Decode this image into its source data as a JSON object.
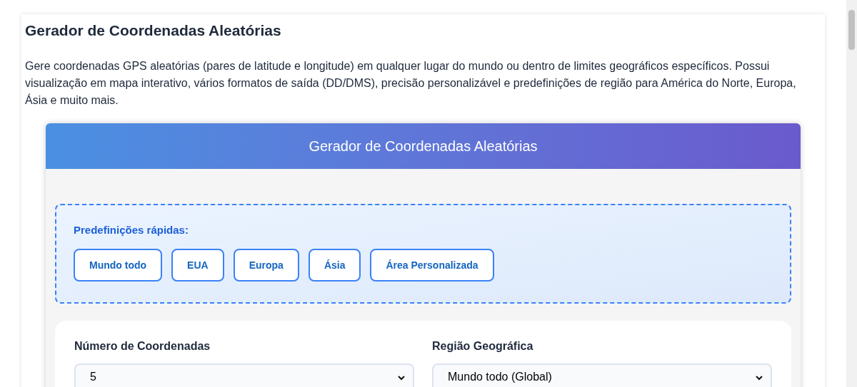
{
  "page": {
    "title": "Gerador de Coordenadas Aleatórias",
    "description": "Gere coordenadas GPS aleatórias (pares de latitude e longitude) em qualquer lugar do mundo ou dentro de limites geográficos específicos. Possui visualização em mapa interativo, vários formatos de saída (DD/DMS), precisão personalizável e predefinições de região para América do Norte, Europa, Ásia e muito mais."
  },
  "tool": {
    "header": "Gerador de Coordenadas Aleatórias",
    "presets": {
      "label": "Predefinições rápidas:",
      "buttons": [
        "Mundo todo",
        "EUA",
        "Europa",
        "Ásia",
        "Área Personalizada"
      ]
    },
    "fields": [
      {
        "label": "Número de Coordenadas",
        "value": "5"
      },
      {
        "label": "Região Geográfica",
        "value": "Mundo todo (Global)"
      }
    ]
  }
}
